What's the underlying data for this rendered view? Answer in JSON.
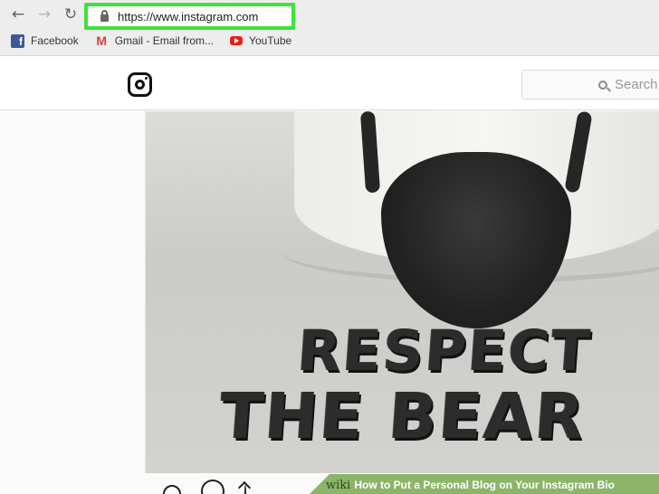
{
  "browser": {
    "url": "https://www.instagram.com",
    "bookmarks": [
      {
        "label": "Facebook",
        "icon": "facebook-icon"
      },
      {
        "label": "Gmail - Email from...",
        "icon": "gmail-icon"
      },
      {
        "label": "YouTube",
        "icon": "youtube-icon"
      }
    ],
    "highlight_color": "#3ee23a"
  },
  "instagram": {
    "search_placeholder": "Search"
  },
  "post": {
    "image_text_line1": "RESPECT",
    "image_text_line2": "THE BEAR"
  },
  "watermark": {
    "brand": "wiki",
    "title": "How to Put a Personal Blog on Your Instagram Bio"
  }
}
